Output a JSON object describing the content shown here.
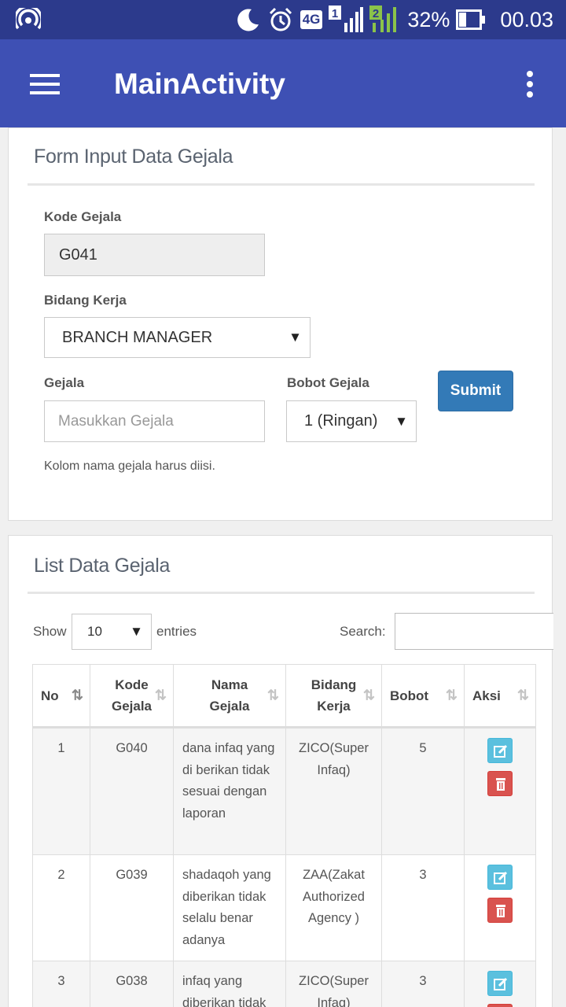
{
  "status": {
    "battery": "32%",
    "time": "00.03",
    "net": "4G",
    "sim1": "1",
    "sim2": "2"
  },
  "appbar": {
    "title": "MainActivity"
  },
  "form": {
    "title": "Form Input Data Gejala",
    "kode_label": "Kode Gejala",
    "kode_value": "G041",
    "bidang_label": "Bidang Kerja",
    "bidang_value": "BRANCH MANAGER",
    "gejala_label": "Gejala",
    "gejala_placeholder": "Masukkan Gejala",
    "bobot_label": "Bobot Gejala",
    "bobot_value": "1 (Ringan)",
    "submit": "Submit",
    "help": "Kolom nama gejala harus diisi."
  },
  "list": {
    "title": "List Data Gejala",
    "show": "Show",
    "entries_value": "10",
    "entries": "entries",
    "search": "Search:",
    "headers": {
      "no": "No",
      "kode": "Kode Gejala",
      "nama": "Nama Gejala",
      "bidang": "Bidang Kerja",
      "bobot": "Bobot",
      "aksi": "Aksi"
    },
    "rows": [
      {
        "no": "1",
        "kode": "G040",
        "nama": "dana infaq yang di berikan tidak sesuai dengan laporan",
        "bidang": "ZICO(Super Infaq)",
        "bobot": "5"
      },
      {
        "no": "2",
        "kode": "G039",
        "nama": "shadaqoh yang diberikan tidak selalu benar adanya",
        "bidang": "ZAA(Zakat Authorized Agency )",
        "bobot": "3"
      },
      {
        "no": "3",
        "kode": "G038",
        "nama": "infaq yang diberikan tidak",
        "bidang": "ZICO(Super Infaq)",
        "bobot": "3"
      }
    ]
  }
}
